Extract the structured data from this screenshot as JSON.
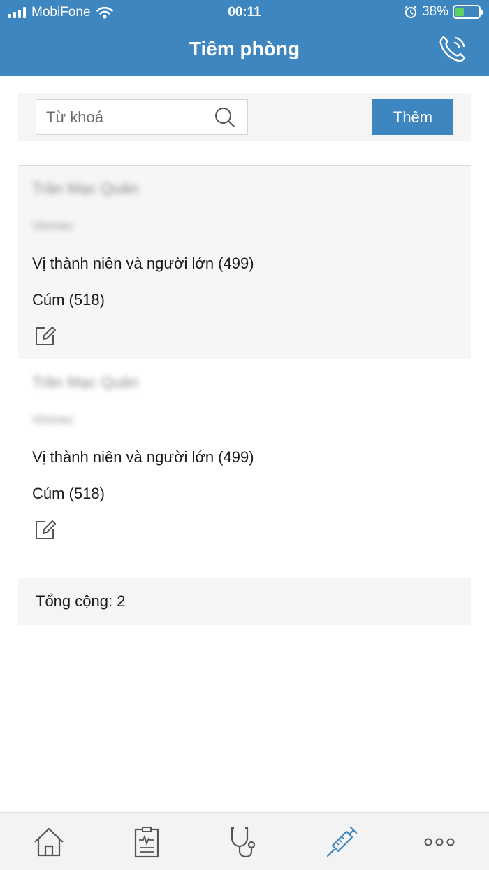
{
  "status_bar": {
    "carrier": "MobiFone",
    "time": "00:11",
    "battery": "38%",
    "battery_level": 0.38
  },
  "header": {
    "title": "Tiêm phòng",
    "call_icon": "phone-call-icon"
  },
  "search": {
    "placeholder": "Từ khoá",
    "value": "",
    "add_label": "Thêm"
  },
  "records": [
    {
      "name": "Trần Mạc Quân",
      "organization": "Vinmec",
      "vaccine": "Vị thành niên và người lớn (499)",
      "flu": "Cúm (518)"
    },
    {
      "name": "Trần Mạc Quân",
      "organization": "Vinmec",
      "vaccine": "Vị thành niên và người lớn (499)",
      "flu": "Cúm (518)"
    }
  ],
  "total": {
    "label": "Tổng cộng: 2"
  },
  "tabbar": {
    "items": [
      {
        "icon": "home-icon"
      },
      {
        "icon": "medical-record-icon"
      },
      {
        "icon": "stethoscope-icon"
      },
      {
        "icon": "syringe-icon",
        "active": true
      },
      {
        "icon": "more-icon"
      }
    ]
  },
  "colors": {
    "primary": "#3e86c0",
    "panel": "#f5f5f5",
    "icon": "#555555"
  }
}
